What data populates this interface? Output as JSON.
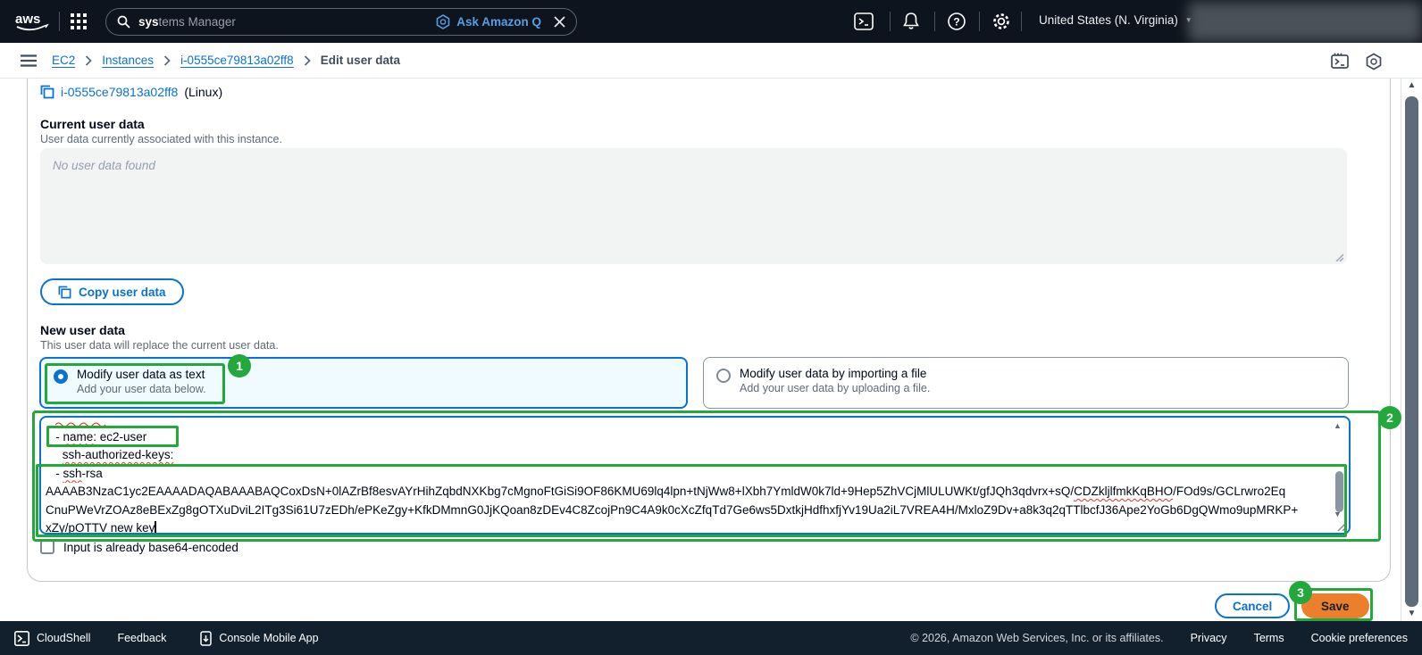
{
  "topbar": {
    "logo_text": "aws",
    "search": {
      "typed": "sys",
      "suggestion": "tems Manager",
      "ask_q_label": "Ask Amazon Q"
    },
    "region_label": "United States (N. Virginia)"
  },
  "icons_glyphs": {
    "scroll_up": "▲",
    "scroll_down": "▼",
    "region_caret": "▼",
    "help_mark": "?"
  },
  "breadcrumb": {
    "items": [
      {
        "label": "EC2"
      },
      {
        "label": "Instances"
      },
      {
        "label": "i-0555ce79813a02ff8"
      }
    ],
    "current": "Edit user data"
  },
  "instance_header": {
    "link": "i-0555ce79813a02ff8",
    "suffix": " (Linux)"
  },
  "current_user_data": {
    "title": "Current user data",
    "description": "User data currently associated with this instance.",
    "placeholder": "No user data found",
    "copy_button_label": "Copy user data"
  },
  "new_user_data": {
    "title": "New user data",
    "description": "This user data will replace the current user data.",
    "options": [
      {
        "label": "Modify user data as text",
        "description": "Add your user data below.",
        "selected": true
      },
      {
        "label": "Modify user data by importing a file",
        "description": "Add your user data by uploading a file.",
        "selected": false
      }
    ],
    "checkbox_label": "Input is already base64-encoded"
  },
  "editor": {
    "lines": [
      {
        "tokens": [
          {
            "t": ""
          }
        ]
      },
      {
        "tokens": [
          {
            "t": "   - "
          },
          {
            "t": "name:",
            "sq": true
          },
          {
            "t": " ec2-user"
          }
        ]
      },
      {
        "tokens": [
          {
            "t": "     "
          },
          {
            "t": "ssh-authorized-keys:",
            "sq": true
          }
        ]
      },
      {
        "tokens": [
          {
            "t": "   - "
          },
          {
            "t": "ssh",
            "sq": true
          },
          {
            "t": "-rsa"
          }
        ]
      },
      {
        "tokens": [
          {
            "t": "AAAAB3NzaC1yc2EAAAADAQABAAABAQCoxDsN+0lAZrBf8esvAYrHihZqbdNXKbg7cMgnoFtGiSi9OF86KMU69lq4lpn+tNjWw8+lXbh7YmldW0k7ld+9Hep5ZhVCjMlULUWKt/gfJQh3qdvrx+sQ/"
          },
          {
            "t": "CDZkljlfmkKqBHO",
            "sq": true
          },
          {
            "t": "/FOd9s/GCLrwro2Eq"
          }
        ]
      },
      {
        "tokens": [
          {
            "t": "CnuPWeVrZOAz8eBExZg8gOTXuDviL2ITg3Si61U7zEDh/ePKeZgy+KfkDMmnG0JjKQoan8zDEv4C8ZcojPn9C4A9k0cXcZfqTd7Ge6ws5DxtkjHdfhxfjYv19Ua2iL7VREA4H/MxloZ9Dv+a8k3q2qTTlbcfJ36Ape2YoGb6DgQWmo9upMRKP+"
          }
        ]
      },
      {
        "tokens": [
          {
            "t": "xZy/"
          },
          {
            "t": "pOTTV",
            "sq": true
          },
          {
            "t": " "
          },
          {
            "t": "new",
            "sq": true
          },
          {
            "t": " "
          },
          {
            "t": "key",
            "sq": true
          }
        ],
        "cursor": true
      }
    ]
  },
  "actions": {
    "cancel_label": "Cancel",
    "save_label": "Save"
  },
  "annotations": {
    "badge1": "1",
    "badge2": "2",
    "badge3": "3",
    "color": "#23a83c"
  },
  "footer": {
    "cloudshell_label": "CloudShell",
    "feedback_label": "Feedback",
    "mobile_label": "Console Mobile App",
    "copyright": "© 2026, Amazon Web Services, Inc. or its affiliates.",
    "links": [
      {
        "label": "Privacy"
      },
      {
        "label": "Terms"
      },
      {
        "label": "Cookie preferences"
      }
    ]
  },
  "colors": {
    "accent_blue": "#0972d3",
    "save_orange": "#ec7f2b",
    "annotation_green": "#23a83c",
    "spellcheck_red": "#e0321c"
  }
}
